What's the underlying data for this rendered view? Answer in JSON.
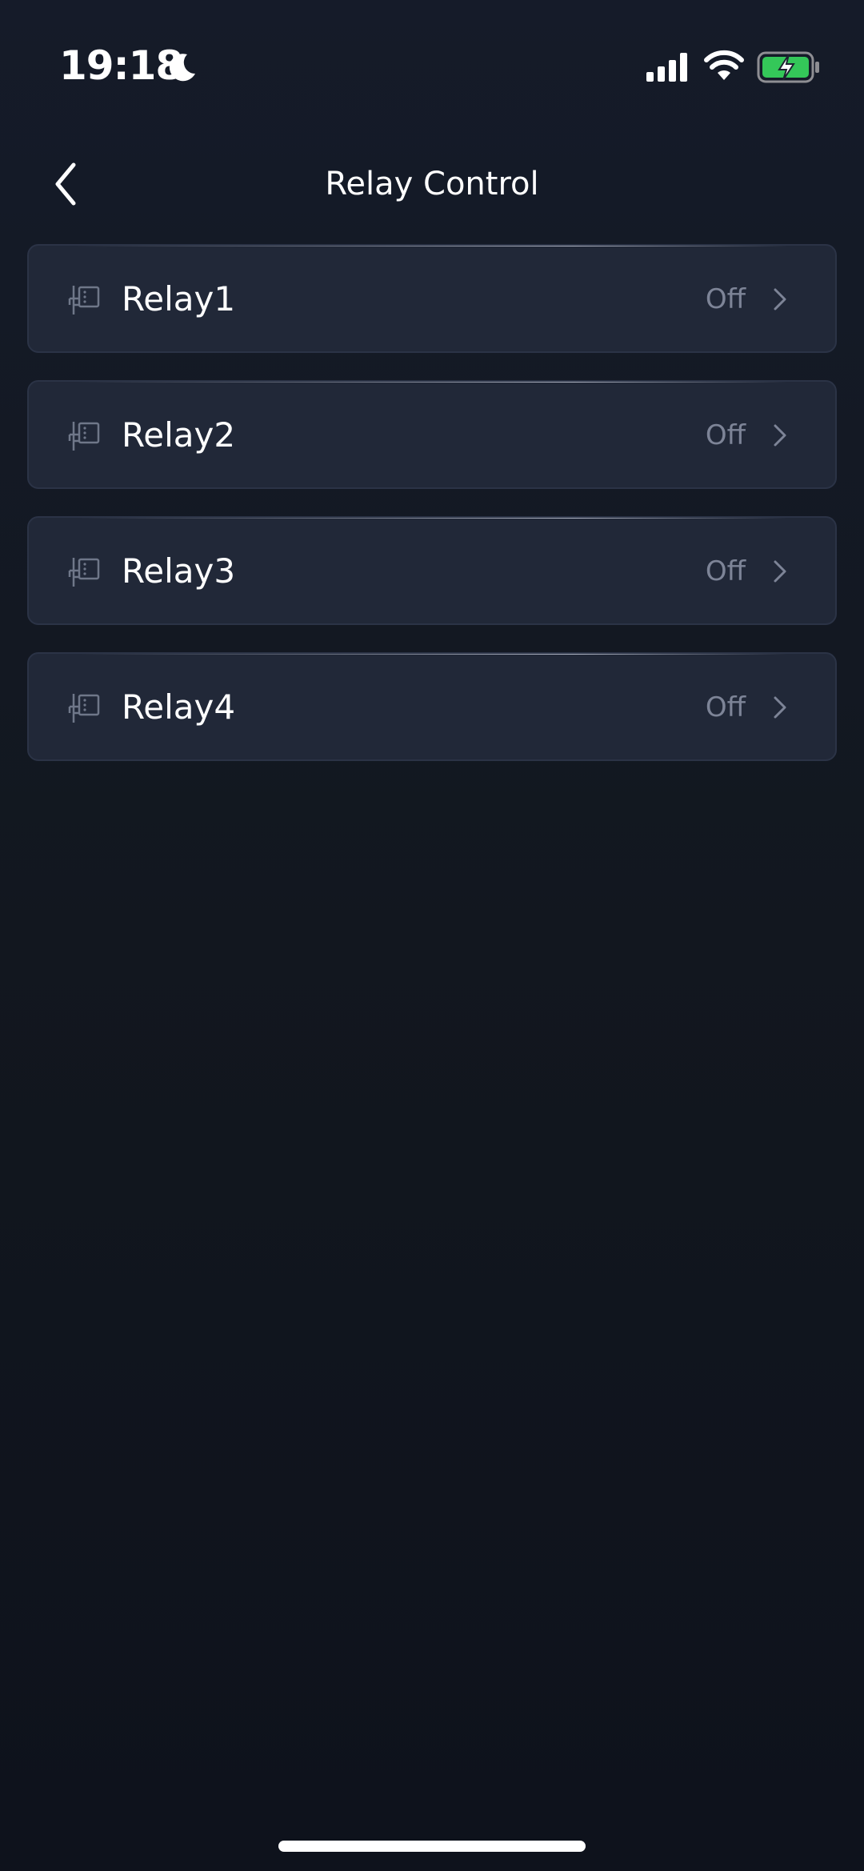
{
  "status_bar": {
    "time": "19:18"
  },
  "header": {
    "title": "Relay Control"
  },
  "relays": [
    {
      "name": "Relay1",
      "status": "Off"
    },
    {
      "name": "Relay2",
      "status": "Off"
    },
    {
      "name": "Relay3",
      "status": "Off"
    },
    {
      "name": "Relay4",
      "status": "Off"
    }
  ],
  "colors": {
    "background": "#131926",
    "card": "#212838",
    "status_text": "#7d8497",
    "battery_green": "#34c759"
  },
  "icons": {
    "back": "chevron-left-icon",
    "relay": "relay-icon",
    "row_arrow": "chevron-right-icon"
  }
}
